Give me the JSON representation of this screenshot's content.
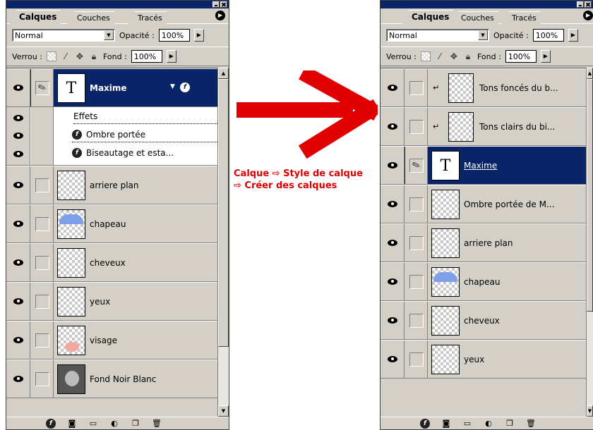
{
  "left_panel": {
    "tabs": [
      "Calques",
      "Couches",
      "Tracés"
    ],
    "active_tab": "Calques",
    "blend_mode": "Normal",
    "opacity_label": "Opacité :",
    "opacity_value": "100%",
    "lock_label": "Verrou :",
    "fill_label": "Fond :",
    "fill_value": "100%",
    "selected_layer": "Maxime",
    "effects_header": "Effets",
    "effects": [
      "Ombre portée",
      "Biseautage et esta..."
    ],
    "layers": [
      "arriere plan",
      "chapeau",
      "cheveux",
      "yeux",
      "visage",
      "Fond Noir Blanc"
    ]
  },
  "right_panel": {
    "tabs": [
      "Calques",
      "Couches",
      "Tracés"
    ],
    "active_tab": "Calques",
    "blend_mode": "Normal",
    "opacity_label": "Opacité :",
    "opacity_value": "100%",
    "lock_label": "Verrou :",
    "fill_label": "Fond :",
    "fill_value": "100%",
    "layers": [
      "Tons foncés du b...",
      "Tons clairs du bi...",
      "Maxime",
      "Ombre portée de M...",
      "arriere plan",
      "chapeau",
      "cheveux",
      "yeux"
    ]
  },
  "caption": {
    "line1": "Calque ⇨ Style de calque",
    "line2": "⇨ Créer des calques"
  },
  "colors": {
    "panel_bg": "#d4d0c8",
    "selection": "#0a246a",
    "arrow": "#e00000"
  }
}
